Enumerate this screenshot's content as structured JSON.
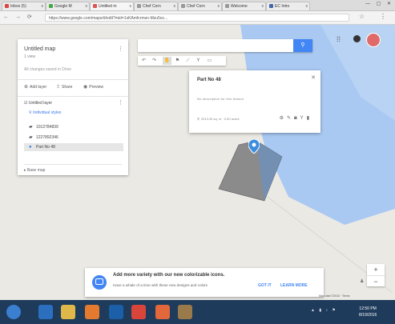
{
  "browser": {
    "tabs": [
      {
        "label": "Inbox (5)"
      },
      {
        "label": "Google M"
      },
      {
        "label": "Untitled m"
      },
      {
        "label": "Chef Corn"
      },
      {
        "label": "Chef Corn"
      },
      {
        "label": "Welcome"
      },
      {
        "label": "EC Intro"
      }
    ],
    "window_controls": "— ▢ ✕",
    "url": "https://www.google.com/maps/d/edit?mid=1sKAmfcrmsn-Mzu5oc..."
  },
  "panel": {
    "title": "Untitled map",
    "views": "1 view",
    "description": "All changes saved in Drive",
    "add_layer": "Add layer",
    "share": "Share",
    "preview": "Preview",
    "layer_name": "Untitled layer",
    "styles_link": "Individual styles",
    "items": [
      "1012784839",
      "1227892346",
      "Part No 48"
    ],
    "base_map": "Base map"
  },
  "search": {
    "placeholder": ""
  },
  "info_window": {
    "title": "Part No 48",
    "description": "No description for this feature",
    "measurement": "2013.26 sq. m · 0.50 acres"
  },
  "banner": {
    "heading": "Add more variety with our new colorizable icons.",
    "subtext": "Have a whale of a time with these new designs and colors",
    "got_it": "GOT IT",
    "learn_more": "LEARN MORE"
  },
  "map_data": "Map data ©2016 · Terms",
  "clock": {
    "time": "12:50 PM",
    "date": "8/19/2016"
  },
  "colors": {
    "accent": "#4285f4",
    "polygon": "#8b8b8b",
    "water": "#a9c9f2"
  }
}
